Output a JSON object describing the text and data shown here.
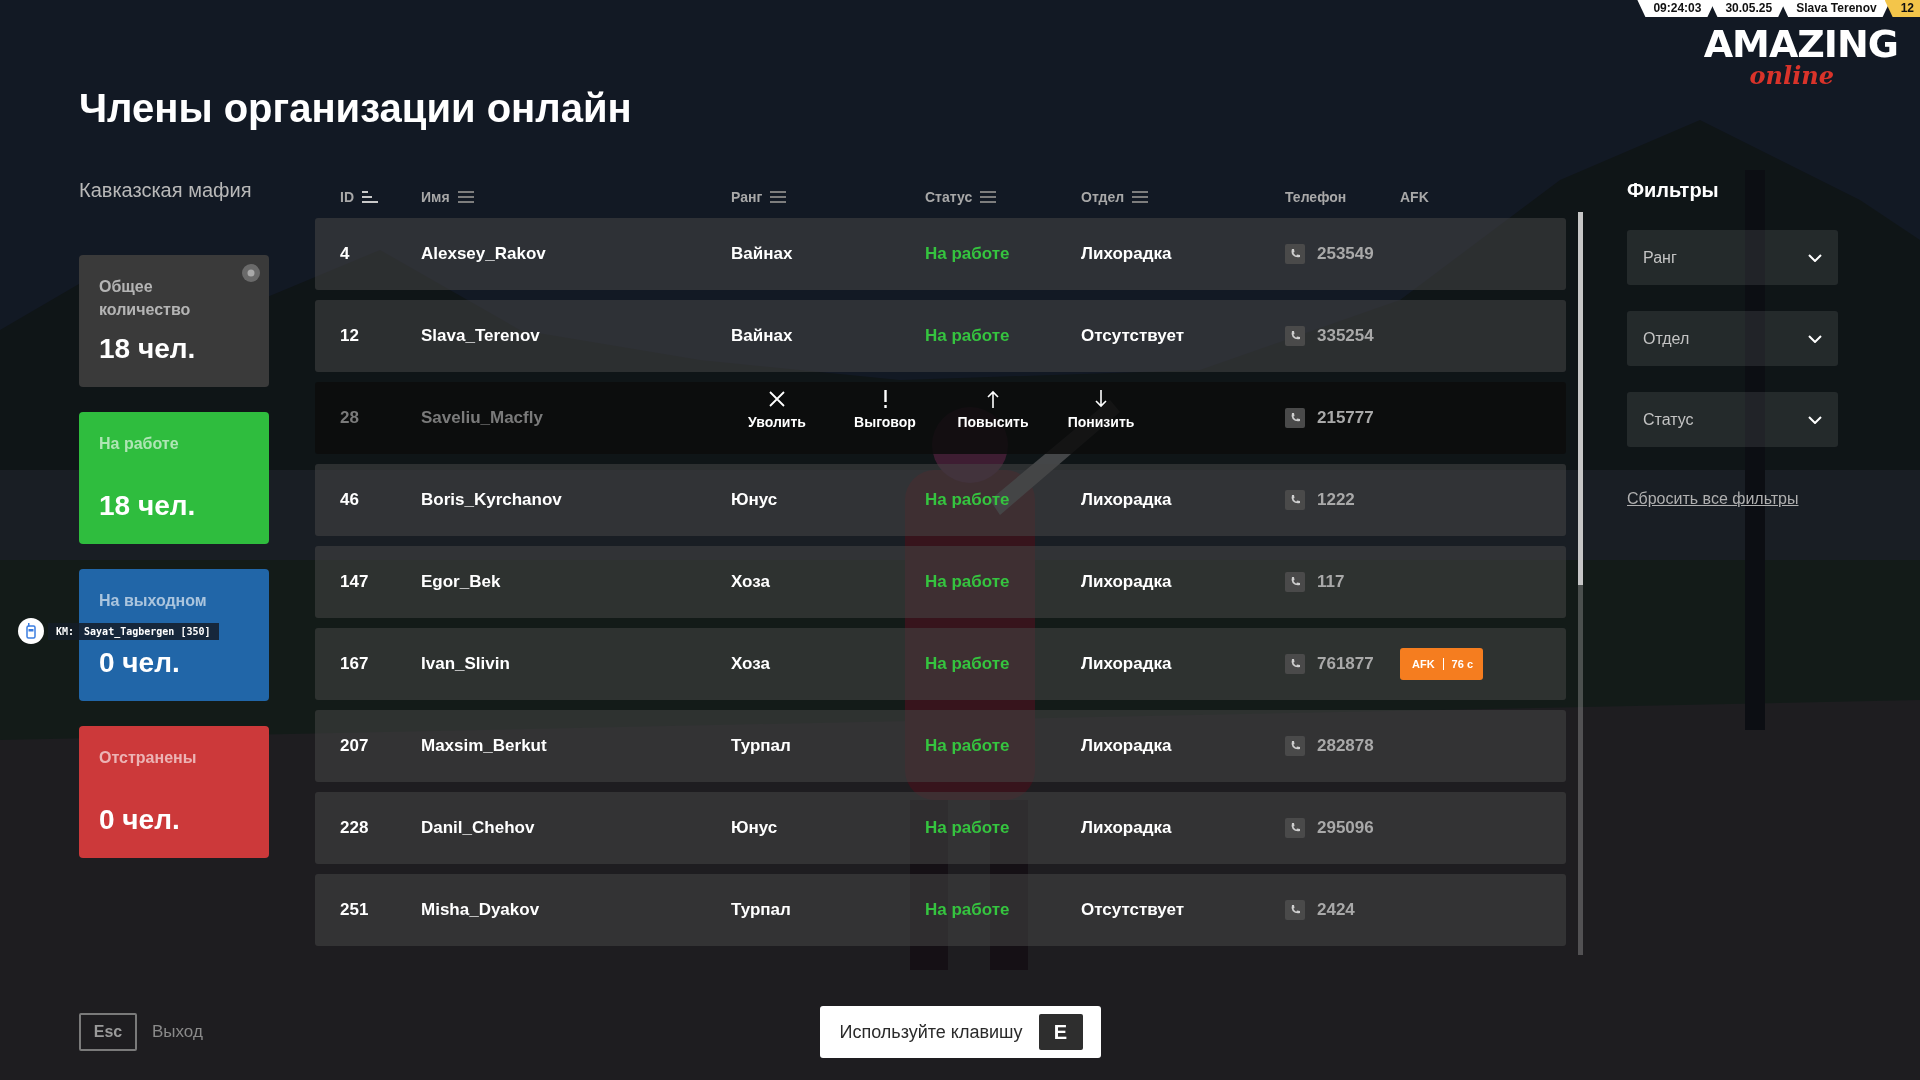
{
  "hud": {
    "time": "09:24:03",
    "date": "30.05.25",
    "player": "Slava Terenov",
    "score": "12"
  },
  "logo": {
    "word": "AMAZING",
    "tagline": "online"
  },
  "title": "Члены организации онлайн",
  "organization": "Кавказская мафия",
  "stats": [
    {
      "label": "Общее количество",
      "value": "18 чел.",
      "color": "#3a3a3a",
      "badge": true
    },
    {
      "label": "На работе",
      "value": "18 чел.",
      "color": "#2fbd3e",
      "badge": false
    },
    {
      "label": "На выходном",
      "value": "0 чел.",
      "color": "#2166a8",
      "badge": false
    },
    {
      "label": "Отстранены",
      "value": "0 чел.",
      "color": "#cc393a",
      "badge": false
    }
  ],
  "table": {
    "columns": [
      {
        "label": "ID",
        "kind": "sortable"
      },
      {
        "label": "Имя",
        "kind": "filterable"
      },
      {
        "label": "Ранг",
        "kind": "filterable"
      },
      {
        "label": "Статус",
        "kind": "filterable"
      },
      {
        "label": "Отдел",
        "kind": "filterable"
      },
      {
        "label": "Телефон",
        "kind": "plain"
      },
      {
        "label": "AFK",
        "kind": "plain"
      }
    ],
    "rows": [
      {
        "id": "4",
        "name": "Alexsey_Rakov",
        "rank": "Вайнах",
        "status": "На работе",
        "department": "Лихорадка",
        "phone": "253549",
        "selected": false
      },
      {
        "id": "12",
        "name": "Slava_Terenov",
        "rank": "Вайнах",
        "status": "На работе",
        "department": "Отсутствует",
        "phone": "335254",
        "selected": false
      },
      {
        "id": "28",
        "name": "Saveliu_Macfly",
        "phone": "215777",
        "selected": true
      },
      {
        "id": "46",
        "name": "Boris_Kyrchanov",
        "rank": "Юнус",
        "status": "На работе",
        "department": "Лихорадка",
        "phone": "1222",
        "selected": false
      },
      {
        "id": "147",
        "name": "Egor_Bek",
        "rank": "Хоза",
        "status": "На работе",
        "department": "Лихорадка",
        "phone": "117",
        "selected": false
      },
      {
        "id": "167",
        "name": "Ivan_Slivin",
        "rank": "Хоза",
        "status": "На работе",
        "department": "Лихорадка",
        "phone": "761877",
        "selected": false,
        "afk": {
          "label": "AFK",
          "time": "76 с"
        }
      },
      {
        "id": "207",
        "name": "Maxsim_Berkut",
        "rank": "Турпал",
        "status": "На работе",
        "department": "Лихорадка",
        "phone": "282878",
        "selected": false
      },
      {
        "id": "228",
        "name": "Danil_Chehov",
        "rank": "Юнус",
        "status": "На работе",
        "department": "Лихорадка",
        "phone": "295096",
        "selected": false
      },
      {
        "id": "251",
        "name": "Misha_Dyakov",
        "rank": "Турпал",
        "status": "На работе",
        "department": "Отсутствует",
        "phone": "2424",
        "selected": false
      }
    ],
    "row_actions": [
      {
        "label": "Уволить",
        "kind": "dismiss"
      },
      {
        "label": "Выговор",
        "kind": "reprimand"
      },
      {
        "label": "Повысить",
        "kind": "promote"
      },
      {
        "label": "Понизить",
        "kind": "demote"
      }
    ]
  },
  "filters": {
    "title": "Фильтры",
    "dropdowns": [
      {
        "label": "Ранг"
      },
      {
        "label": "Отдел"
      },
      {
        "label": "Статус"
      }
    ],
    "reset": "Сбросить все фильтры"
  },
  "radio": {
    "channel": "КМ:",
    "text": "Sayat_Tagbergen [350]"
  },
  "footer": {
    "exit_key": "Esc",
    "exit_label": "Выход",
    "hint": "Используйте клавишу",
    "hint_key": "E"
  }
}
